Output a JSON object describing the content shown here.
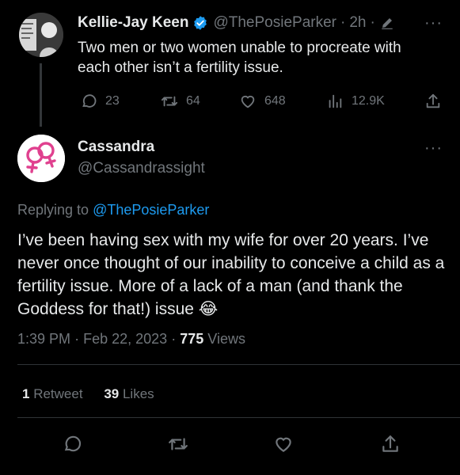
{
  "parent": {
    "name": "Kellie-Jay Keen",
    "handle": "@ThePosieParker",
    "time": "2h",
    "text": "Two men or two women unable to procreate with each other isn’t a fertility issue.",
    "replies": "23",
    "retweets": "64",
    "likes": "648",
    "views": "12.9K"
  },
  "reply": {
    "name": "Cassandra",
    "handle": "@Cassandrassight",
    "replying_prefix": "Replying to",
    "replying_handle": "@ThePosieParker",
    "text": "I’ve been having sex with my wife for over 20 years. I’ve never once thought of our inability to conceive a child as a fertility issue. More of a lack of a man (and thank the Goddess for that!) issue",
    "emoji": "😂",
    "time": "1:39 PM",
    "date": "Feb 22, 2023",
    "views_count": "775",
    "views_label": "Views",
    "retweet_count": "1",
    "retweet_label": "Retweet",
    "like_count": "39",
    "like_label": "Likes"
  },
  "icons": {
    "verified": "verified-badge-icon",
    "edit": "pencil-icon",
    "more": "more-dots-icon",
    "reply": "comment-icon",
    "retweet": "retweet-icon",
    "like": "heart-icon",
    "views": "bar-chart-icon",
    "share": "share-icon",
    "avatar_symbol": "interlocked-venus-icon"
  },
  "colors": {
    "background": "#000000",
    "text": "#e7e9ea",
    "muted": "#71767b",
    "accent": "#1d9bf0",
    "avatar_symbol": "#e0418f"
  }
}
